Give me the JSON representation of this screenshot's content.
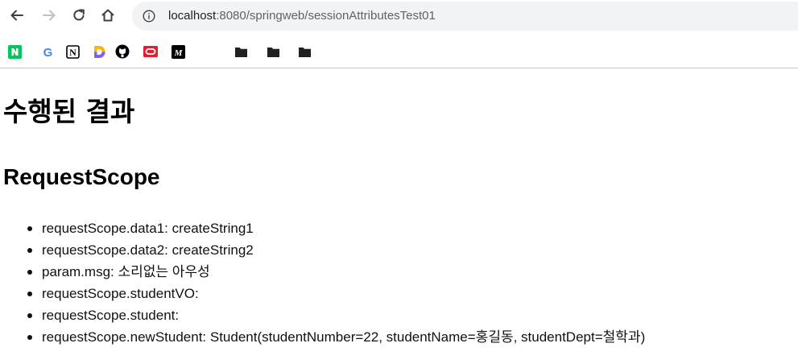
{
  "browser": {
    "url_host": "localhost",
    "url_path": ":8080/springweb/sessionAttributesTest01",
    "bookmarks": [
      {
        "name": "naver",
        "label": "N",
        "color": "#03c75a"
      },
      {
        "name": "google",
        "label": "G",
        "color": "#4285f4"
      },
      {
        "name": "notion",
        "label": "N",
        "color": "#000000"
      },
      {
        "name": "daum",
        "label": "D",
        "color": "#ff5a4a"
      },
      {
        "name": "github",
        "label": "",
        "color": "#000000"
      },
      {
        "name": "oracle",
        "label": "",
        "color": "#e0202c"
      },
      {
        "name": "medium",
        "label": "M",
        "color": "#000000"
      },
      {
        "name": "folder",
        "label": "",
        "color": "#202124"
      },
      {
        "name": "folder",
        "label": "",
        "color": "#202124"
      },
      {
        "name": "folder",
        "label": "",
        "color": "#202124"
      }
    ]
  },
  "page": {
    "title": "수행된 결과",
    "section": "RequestScope",
    "items": [
      "requestScope.data1: createString1",
      "requestScope.data2: createString2",
      "param.msg: 소리없는 아우성",
      "requestScope.studentVO:",
      "requestScope.student:",
      "requestScope.newStudent: Student(studentNumber=22, studentName=홍길동, studentDept=철학과)"
    ]
  }
}
